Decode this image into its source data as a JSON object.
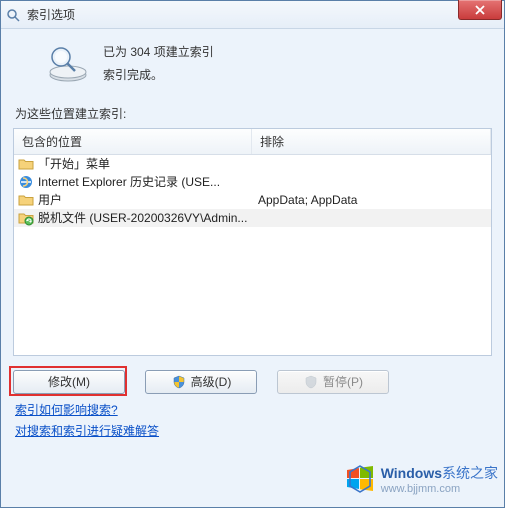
{
  "window": {
    "title": "索引选项"
  },
  "status": {
    "line1": "已为 304 项建立索引",
    "line2": "索引完成。"
  },
  "sectionLabel": "为这些位置建立索引:",
  "columns": {
    "location": "包含的位置",
    "exclude": "排除"
  },
  "rows": [
    {
      "icon": "folder",
      "label": "「开始」菜单",
      "exclude": ""
    },
    {
      "icon": "ie",
      "label": "Internet Explorer 历史记录 (USE...",
      "exclude": ""
    },
    {
      "icon": "folder",
      "label": "用户",
      "exclude": "AppData; AppData"
    },
    {
      "icon": "offline",
      "label": "脱机文件 (USER-20200326VY\\Admin...",
      "exclude": ""
    }
  ],
  "buttons": {
    "modify": "修改(M)",
    "advanced": "高级(D)",
    "pause": "暂停(P)"
  },
  "links": {
    "howAffects": "索引如何影响搜索?",
    "troubleshoot": "对搜索和索引进行疑难解答"
  },
  "watermark": {
    "brand": "Windows",
    "suffix": "系统之家",
    "url": "www.bjjmm.com"
  }
}
